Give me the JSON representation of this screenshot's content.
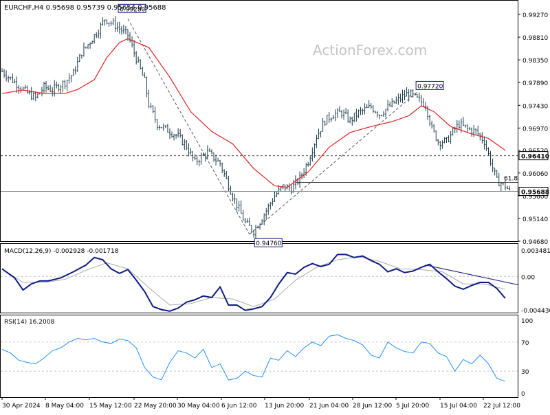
{
  "header": {
    "symbol_info": "EURCHF,H4  0.95698 0.95739 0.95654 0.95688",
    "watermark": "ActionForex.com"
  },
  "colors": {
    "background": "#ffffff",
    "bars": "#1a3a4a",
    "ma_line": "#e02020",
    "macd_main": "#0d1a80",
    "macd_signal": "#a9a9a9",
    "rsi_line": "#1e90ff",
    "level_line": "#444444",
    "grid": "#c8c8c8",
    "text": "#000000"
  },
  "chart_data": [
    {
      "type": "candlestick",
      "panel": "price",
      "title": "EURCHF,H4",
      "ylim": [
        0.9468,
        0.9927
      ],
      "y_ticks": [
        "0.99270",
        "0.98810",
        "0.98350",
        "0.97890",
        "0.97430",
        "0.96970",
        "0.96520",
        "0.96060",
        "0.95600",
        "0.95140",
        "0.94680"
      ],
      "x_ticks": [
        "30 Apr 2024",
        "8 May 04:00",
        "15 May 12:00",
        "22 May 20:00",
        "30 May 04:00",
        "6 Jun 12:00",
        "13 Jun 20:00",
        "21 Jun 04:00",
        "28 Jun 12:00",
        "5 Jul 20:00",
        "15 Jul 04:00",
        "22 Jul 12:00"
      ],
      "current_price": "0.95688",
      "annotations": [
        {
          "label": "0.99280",
          "value": 0.9928
        },
        {
          "label": "0.94760",
          "value": 0.9476
        },
        {
          "label": "0.97720",
          "value": 0.9772
        },
        {
          "label": "0.96410",
          "value": 0.9641
        },
        {
          "label": "61.8",
          "value": 0.9587
        },
        {
          "label": "0.95688",
          "value": 0.95688
        }
      ],
      "series": [
        {
          "name": "close_path",
          "x": [
            0,
            6,
            12,
            16,
            20,
            24,
            30,
            34,
            38,
            42,
            46,
            49,
            54,
            60,
            64,
            68,
            70,
            74,
            80,
            84,
            88,
            92,
            98,
            104,
            110,
            116,
            120,
            124,
            130,
            134,
            138,
            142,
            146,
            150,
            154,
            158,
            162,
            166,
            170,
            176,
            180,
            186,
            190,
            194,
            198,
            202,
            205,
            208,
            212,
            216,
            218,
            222,
            226,
            230,
            236,
            240,
            242
          ],
          "y": [
            0.9812,
            0.979,
            0.9768,
            0.9758,
            0.978,
            0.9774,
            0.979,
            0.9808,
            0.985,
            0.9872,
            0.9896,
            0.9918,
            0.9905,
            0.9885,
            0.9838,
            0.9792,
            0.9745,
            0.9705,
            0.969,
            0.968,
            0.966,
            0.9628,
            0.9648,
            0.9625,
            0.956,
            0.9505,
            0.9488,
            0.9515,
            0.956,
            0.9578,
            0.9575,
            0.9595,
            0.963,
            0.968,
            0.9712,
            0.9725,
            0.9728,
            0.9712,
            0.9728,
            0.974,
            0.9725,
            0.9745,
            0.9758,
            0.9768,
            0.9755,
            0.9745,
            0.9695,
            0.967,
            0.967,
            0.9695,
            0.9705,
            0.9695,
            0.969,
            0.967,
            0.959,
            0.958,
            0.9569
          ]
        },
        {
          "name": "MA",
          "x": [
            0,
            10,
            20,
            30,
            36,
            44,
            50,
            56,
            60,
            70,
            80,
            90,
            100,
            110,
            120,
            130,
            136,
            146,
            156,
            166,
            176,
            186,
            194,
            200,
            206,
            214,
            224,
            232,
            240
          ],
          "y": [
            0.9767,
            0.9774,
            0.9767,
            0.9767,
            0.9775,
            0.9795,
            0.984,
            0.987,
            0.9878,
            0.986,
            0.98,
            0.973,
            0.969,
            0.9665,
            0.9615,
            0.958,
            0.9577,
            0.9608,
            0.9658,
            0.9688,
            0.97,
            0.971,
            0.9722,
            0.9742,
            0.973,
            0.97,
            0.9685,
            0.9676,
            0.9652
          ]
        }
      ]
    },
    {
      "type": "line",
      "panel": "macd",
      "title": "MACD(12,26,9) -0.002928 -0.001718",
      "ylim": [
        -0.004436,
        0.003481
      ],
      "y_ticks": [
        "0.003481",
        "0.00",
        "-0.004436"
      ],
      "series": [
        {
          "name": "MACD",
          "x": [
            0,
            6,
            10,
            14,
            18,
            22,
            28,
            34,
            40,
            44,
            48,
            52,
            56,
            60,
            64,
            68,
            72,
            76,
            80,
            84,
            88,
            92,
            96,
            100,
            104,
            108,
            112,
            116,
            120,
            124,
            128,
            132,
            136,
            140,
            144,
            148,
            152,
            156,
            160,
            164,
            168,
            172,
            176,
            180,
            184,
            188,
            192,
            196,
            200,
            204,
            208,
            212,
            216,
            220,
            224,
            228,
            232,
            236,
            240
          ],
          "y": [
            0.001,
            -0.0002,
            -0.0018,
            -0.001,
            -0.0006,
            -0.0006,
            -0.0002,
            0.0006,
            0.0015,
            0.0025,
            0.0022,
            0.001,
            0.0004,
            0.0009,
            -0.0005,
            -0.002,
            -0.004,
            -0.0044,
            -0.0046,
            -0.0042,
            -0.0034,
            -0.0031,
            -0.0026,
            -0.0028,
            -0.0014,
            -0.0038,
            -0.0038,
            -0.0045,
            -0.0043,
            -0.004,
            -0.0028,
            -0.001,
            0.0005,
            0.0003,
            0.0012,
            0.0017,
            0.0013,
            0.0016,
            0.0029,
            0.0029,
            0.0025,
            0.0027,
            0.0021,
            0.0016,
            0.0006,
            0.001,
            0.0005,
            0.0007,
            0.0012,
            0.0016,
            0.0006,
            -0.0003,
            -0.0013,
            -0.0017,
            -0.0012,
            -0.0008,
            -0.0008,
            -0.0016,
            -0.0029
          ]
        },
        {
          "name": "signal",
          "x": [
            0,
            10,
            20,
            30,
            40,
            50,
            60,
            70,
            80,
            90,
            100,
            110,
            120,
            130,
            140,
            150,
            160,
            170,
            180,
            190,
            200,
            210,
            220,
            230,
            240
          ],
          "y": [
            0.001,
            -0.0008,
            -0.0008,
            -0.0004,
            0.0008,
            0.0018,
            0.001,
            -0.0015,
            -0.0038,
            -0.0036,
            -0.0028,
            -0.003,
            -0.004,
            -0.003,
            -0.0005,
            0.0012,
            0.0022,
            0.0026,
            0.002,
            0.001,
            0.0009,
            0.0006,
            -0.001,
            -0.001,
            -0.0017
          ]
        },
        {
          "name": "trendline",
          "x": [
            202,
            240
          ],
          "y": [
            0.0015,
            -0.0011
          ]
        }
      ]
    },
    {
      "type": "line",
      "panel": "rsi",
      "title": "RSI(14) 16.2008",
      "ylim": [
        0,
        100
      ],
      "y_ticks": [
        "100",
        "70",
        "30",
        "0"
      ],
      "series": [
        {
          "name": "RSI",
          "x": [
            0,
            4,
            8,
            12,
            16,
            20,
            24,
            28,
            32,
            36,
            40,
            44,
            48,
            52,
            56,
            60,
            64,
            68,
            72,
            76,
            80,
            84,
            88,
            92,
            96,
            100,
            104,
            108,
            112,
            116,
            120,
            124,
            128,
            132,
            136,
            140,
            144,
            148,
            152,
            156,
            160,
            164,
            168,
            172,
            176,
            180,
            184,
            188,
            192,
            196,
            200,
            204,
            208,
            212,
            216,
            220,
            224,
            228,
            232,
            236,
            240
          ],
          "y": [
            60,
            55,
            45,
            42,
            40,
            48,
            58,
            62,
            70,
            75,
            73,
            75,
            70,
            68,
            74,
            72,
            62,
            35,
            22,
            18,
            42,
            58,
            55,
            48,
            60,
            35,
            40,
            18,
            20,
            30,
            24,
            22,
            48,
            45,
            58,
            50,
            62,
            70,
            65,
            78,
            80,
            75,
            72,
            66,
            52,
            48,
            70,
            62,
            57,
            55,
            70,
            68,
            55,
            50,
            30,
            46,
            40,
            52,
            40,
            20,
            16
          ]
        }
      ]
    }
  ]
}
